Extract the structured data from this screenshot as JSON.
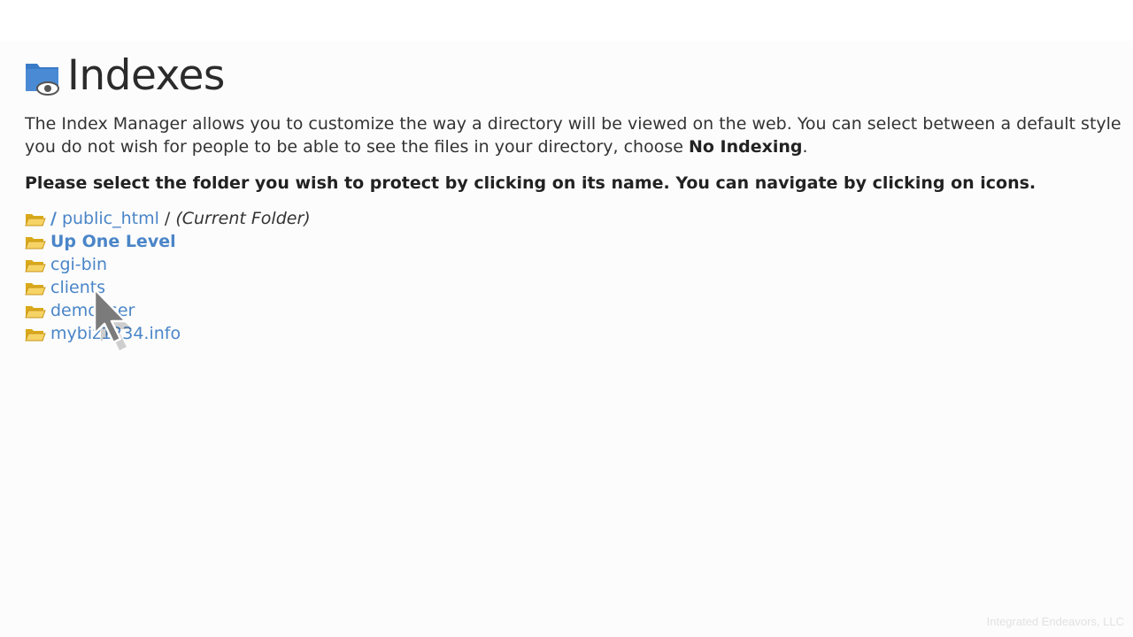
{
  "header": {
    "title": "Indexes",
    "icon": "folder-eye-icon"
  },
  "intro": {
    "line1": "The Index Manager allows you to customize the way a directory will be viewed on the web. You can select between a default style",
    "line2_before": "you do not wish for people to be able to see the files in your directory, choose ",
    "line2_bold": "No Indexing",
    "line2_after": "."
  },
  "instruction": "Please select the folder you wish to protect by clicking on its name. You can navigate by clicking on icons.",
  "breadcrumb": {
    "root": "/",
    "folder": "public_html",
    "separator": "/",
    "note": "(Current Folder)"
  },
  "folders": {
    "up": "Up One Level",
    "items": [
      "cgi-bin",
      "clients",
      "demouser",
      "mybiz1234.info"
    ]
  },
  "colors": {
    "link": "#4a85c8",
    "folder": "#f0c419",
    "title_icon": "#3a7bc8"
  },
  "watermark": "Integrated Endeavors, LLC"
}
